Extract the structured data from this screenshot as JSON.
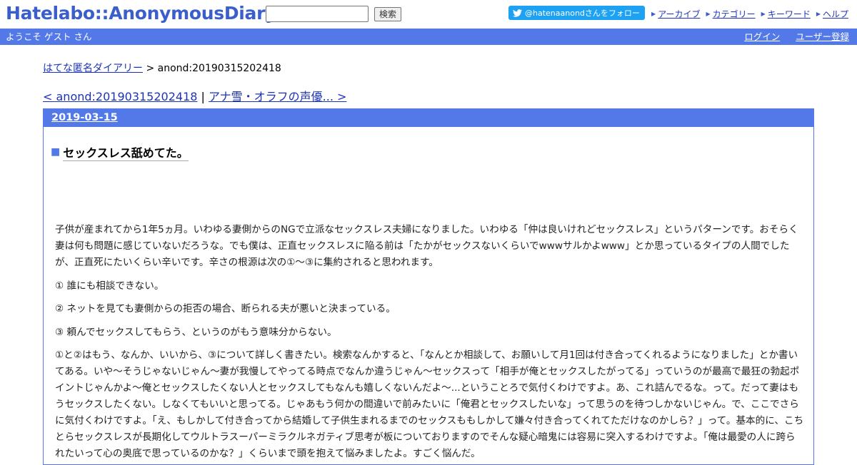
{
  "header": {
    "logo": "Hatelabo::AnonymousDiary",
    "search_placeholder": "",
    "search_button": "検索",
    "follow_button": "@hatenaanondさんをフォロー",
    "links": [
      "アーカイブ",
      "カテゴリー",
      "キーワード",
      "ヘルプ"
    ]
  },
  "welcome_bar": {
    "text": "ようこそ ゲスト さん",
    "login": "ログイン",
    "register": "ユーザー登録"
  },
  "breadcrumb": {
    "home": "はてな匿名ダイアリー",
    "separator": " > ",
    "current": "anond:20190315202418"
  },
  "pager": {
    "prev": "< anond:20190315202418",
    "separator": " | ",
    "next": "アナ雪・オラフの声優... >"
  },
  "day": {
    "date": "2019-03-15",
    "title_mark": "■",
    "title": "セックスレス舐めてた。",
    "paragraphs": [
      "子供が産まれてから1年5ヵ月。いわゆる妻側からのNGで立派なセックスレス夫婦になりました。いわゆる「仲は良いけれどセックスレス」というパターンです。おそらく妻は何も問題に感じていないだろうな。でも僕は、正直セックスレスに陥る前は「たかがセックスないくらいでwwwサルかよwww」とか思っているタイプの人間でしたが、正直死にたいくらい辛いです。辛さの根源は次の①～③に集約されると思われます。",
      "① 誰にも相談できない。",
      "② ネットを見ても妻側からの拒否の場合、断られる夫が悪いと決まっている。",
      "③ 頼んでセックスしてもらう、というのがもう意味分からない。",
      "①と②はもう、なんか、いいから、③について詳しく書きたい。検索なんかすると、「なんとか相談して、お願いして月1回は付き合ってくれるようになりました」とか書いてある。いや～そうじゃないじゃん～妻が我慢してやってる時点でなんか違うじゃん～セックスって「相手が俺とセックスしたがってる」っていうのが最高で最狂の勃起ポイントじゃんかよ～俺とセックスしたくない人とセックスしてもなんも嬉しくないんだよ～...ということろで気付くわけですよ。あ、これ詰んでるな。って。だって妻はもうセックスしたくない。しなくてもいいと思ってる。じゃあもう何かの間違いで前みたいに「俺君とセックスしたいな」って思うのを待つしかないじゃん。で、ここでさらに気付くわけですよ。「え、もしかして付き合ってから結婚して子供生まれるまでのセックスももしかして嫌々付き合ってくれてただけなのかしら？」って。基本的に、こちとらセックスレスが長期化してウルトラスーパーミラクルネガティブ思考が板についておりますのでそんな疑心暗鬼には容易に突入するわけですよ。「俺は最愛の人に跨られたいって心の奥底で思っているのかな？」くらいまで頭を抱えて悩みましたよ。すごく悩んだ。"
    ]
  }
}
